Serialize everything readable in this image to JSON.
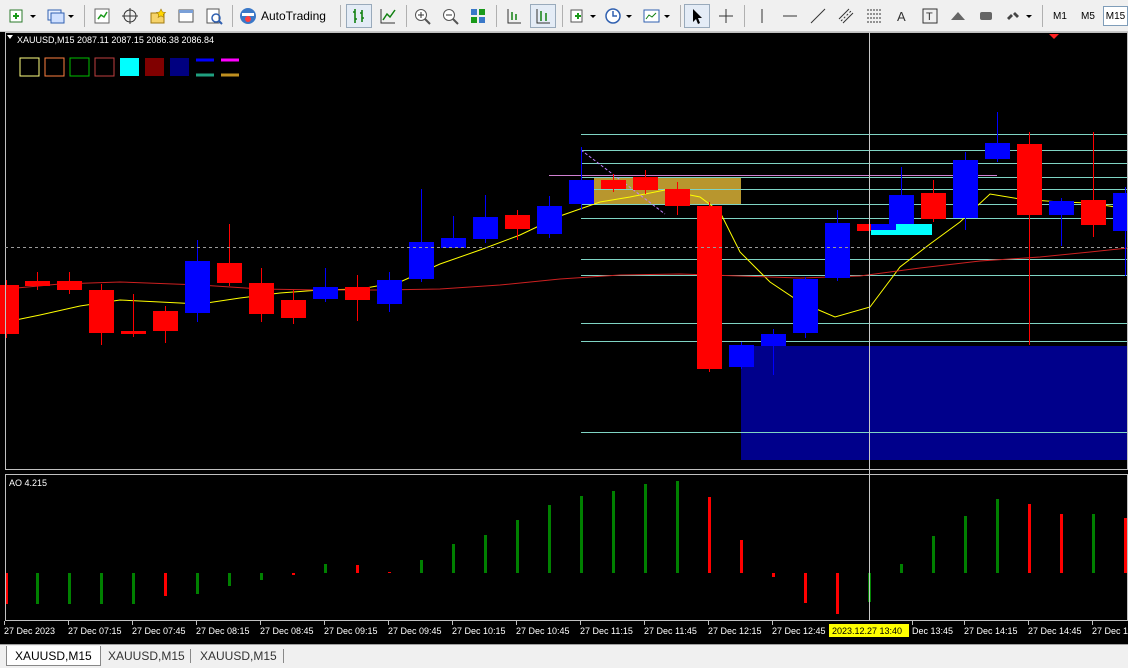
{
  "toolbar": {
    "autotrading_label": "AutoTrading",
    "timeframes": [
      "M1",
      "M5",
      "M15"
    ],
    "active_timeframe": "M15"
  },
  "chart": {
    "header": "XAUUSD,M15  2087.11 2087.15 2086.38 2086.84",
    "indicator_label": "AO 4.215",
    "crosshair_time_label": "2023.12.27 13:40",
    "time_labels": [
      "27 Dec 2023",
      "27 Dec 07:15",
      "27 Dec 07:45",
      "27 Dec 08:15",
      "27 Dec 08:45",
      "27 Dec 09:15",
      "27 Dec 09:45",
      "27 Dec 10:15",
      "27 Dec 10:45",
      "27 Dec 11:15",
      "27 Dec 11:45",
      "27 Dec 12:15",
      "27 Dec 12:45",
      "Dec 13:45",
      "27 Dec 14:15",
      "27 Dec 14:45",
      "27 Dec 1"
    ],
    "colors": {
      "bull": "#0000ff",
      "bear": "#ff0000",
      "ma_yellow": "#ffff00",
      "ma_red": "#cc2020",
      "ao_up": "#008000",
      "ao_down": "#ff0000",
      "zone": "#00008b",
      "gold_zone": "#b8962e",
      "level_line": "#7fd4c4",
      "cyan": "#00ffff"
    },
    "legend_swatches": [
      {
        "name": "yellow-outline-swatch",
        "color": "#ffff80"
      },
      {
        "name": "orange-outline-swatch",
        "color": "#ff8040"
      },
      {
        "name": "green-outline-swatch",
        "color": "#00c000"
      },
      {
        "name": "red-outline-swatch",
        "color": "#c04040"
      },
      {
        "name": "cyan-swatch",
        "color": "#00ffff"
      },
      {
        "name": "maroon-swatch",
        "color": "#800000"
      },
      {
        "name": "navy-swatch",
        "color": "#000080"
      }
    ]
  },
  "tabs": [
    "XAUUSD,M15",
    "XAUUSD,M15",
    "XAUUSD,M15"
  ]
}
